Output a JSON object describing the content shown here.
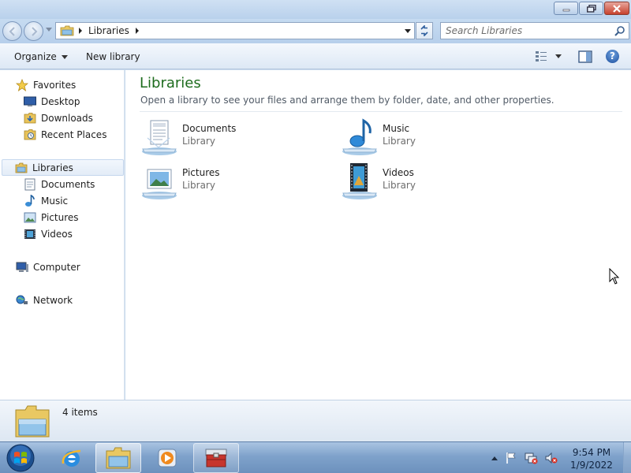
{
  "window": {
    "buttons": {
      "minimize": "minimize",
      "maximize": "maximize",
      "close": "close"
    }
  },
  "address": {
    "crumb": "Libraries",
    "search_placeholder": "Search Libraries"
  },
  "toolbar": {
    "organize_label": "Organize",
    "new_library_label": "New library",
    "help_label": "?"
  },
  "navpane": {
    "favorites": {
      "label": "Favorites",
      "items": [
        {
          "label": "Desktop",
          "icon": "desktop-icon"
        },
        {
          "label": "Downloads",
          "icon": "downloads-folder-icon"
        },
        {
          "label": "Recent Places",
          "icon": "recent-places-icon"
        }
      ]
    },
    "libraries": {
      "label": "Libraries",
      "items": [
        {
          "label": "Documents",
          "icon": "documents-icon"
        },
        {
          "label": "Music",
          "icon": "music-icon"
        },
        {
          "label": "Pictures",
          "icon": "pictures-icon"
        },
        {
          "label": "Videos",
          "icon": "videos-icon"
        }
      ]
    },
    "computer": {
      "label": "Computer",
      "icon": "computer-icon"
    },
    "network": {
      "label": "Network",
      "icon": "network-icon"
    }
  },
  "content": {
    "title": "Libraries",
    "description": "Open a library to see your files and arrange them by folder, date, and other properties.",
    "libraries": [
      {
        "name": "Documents",
        "type": "Library",
        "icon": "documents-library-icon"
      },
      {
        "name": "Music",
        "type": "Library",
        "icon": "music-library-icon"
      },
      {
        "name": "Pictures",
        "type": "Library",
        "icon": "pictures-library-icon"
      },
      {
        "name": "Videos",
        "type": "Library",
        "icon": "videos-library-icon"
      }
    ]
  },
  "details": {
    "item_count": "4 items"
  },
  "taskbar": {
    "apps": [
      {
        "name": "Internet Explorer",
        "icon": "internet-explorer-icon",
        "state": "pinned"
      },
      {
        "name": "Windows Explorer",
        "icon": "windows-explorer-icon",
        "state": "active"
      },
      {
        "name": "Windows Media Player",
        "icon": "media-player-icon",
        "state": "pinned"
      },
      {
        "name": "Toolbox",
        "icon": "toolbox-icon",
        "state": "open"
      }
    ],
    "clock": {
      "time": "9:54 PM",
      "date": "1/9/2022"
    }
  },
  "colors": {
    "title_green": "#1e6c1e",
    "frame_blue": "#c6dbf1",
    "taskbar_blue": "#7fa2cb"
  }
}
